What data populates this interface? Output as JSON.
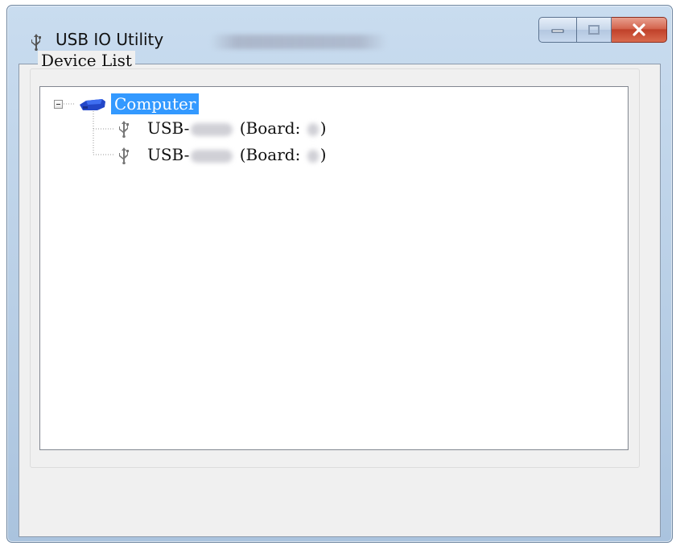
{
  "window": {
    "title": "USB IO Utility",
    "buttons": {
      "minimize": "minimize",
      "maximize": "maximize",
      "close": "close"
    }
  },
  "device_list": {
    "label": "Device List",
    "root": {
      "label": "Computer",
      "selected": true,
      "expanded": true
    },
    "children": [
      {
        "prefix": "USB-",
        "board_label": "(Board:",
        "suffix": ")"
      },
      {
        "prefix": "USB-",
        "board_label": "(Board:",
        "suffix": ")"
      }
    ]
  },
  "icons": {
    "app": "usb-icon",
    "root": "computer-icon",
    "child": "usb-icon",
    "expander": "collapse-minus-icon"
  },
  "colors": {
    "selection": "#3399ff",
    "close_button": "#c0412a"
  }
}
